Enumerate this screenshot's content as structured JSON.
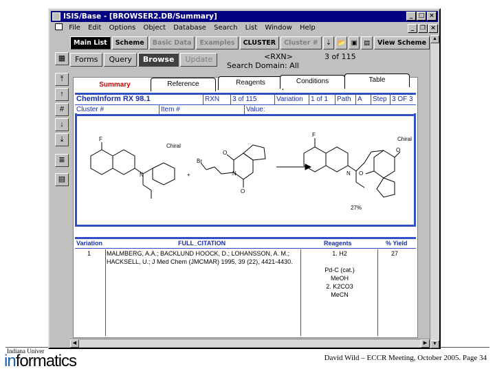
{
  "window": {
    "title": "ISIS/Base - [BROWSER2.DB/Summary]"
  },
  "menu": [
    "File",
    "Edit",
    "Options",
    "Object",
    "Database",
    "Search",
    "List",
    "Window",
    "Help"
  ],
  "toolbar": [
    "Main List",
    "Scheme",
    "Basic Data",
    "Examples",
    "CLUSTER",
    "Cluster #"
  ],
  "toolbar_right": "View Scheme",
  "nav": [
    "Forms",
    "Query",
    "Browse",
    "Update"
  ],
  "record": {
    "rxn": "<RXN>",
    "count": "3   of 115",
    "domain": "Search Domain: All"
  },
  "tabs": [
    "Summary",
    "Reference",
    "Reagents",
    "Conditions",
    "Table"
  ],
  "row1": {
    "db": "ChemInform RX 98.1",
    "rxn_label": "RXN",
    "rxn_val": "3 of 115",
    "variation_label": "Variation",
    "variation_val": "1 of 1",
    "path_label": "Path",
    "path_val": "A",
    "step_label": "Step",
    "step_val": "3 OF 3"
  },
  "row2": {
    "cluster": "Cluster #",
    "item": "Item #",
    "value": "Value:"
  },
  "reaction": {
    "chiral_left": "Chiral",
    "chiral_right": "Chiral",
    "yield": "27%",
    "f1": "F",
    "f2": "F",
    "br": "Br",
    "o": "O",
    "n": "N",
    "plus": "+"
  },
  "citation_head": {
    "variation": "Variation",
    "full": "FULL_CITATION",
    "reagents": "Reagents",
    "yield": "% Yield"
  },
  "citation": {
    "variation": "1",
    "text_1": "MALMBERG, A.A.; BACKLUND HOOCK, D.; LOHANSSON, A. M.;",
    "text_2": "HACKSELL, U.; J Med Chem (JMCMAR) 1995, 39 (22), 4421-4430.",
    "reagents": [
      "1. H2",
      "",
      "Pd-C (cat.)",
      "MeOH",
      "2. K2CO3",
      "MeCN"
    ],
    "yield": "27"
  },
  "slide": {
    "org": "Indiana Univer",
    "logo_1": "in",
    "logo_2": "formatics",
    "footer": "David Wild – ECCR Meeting, October 2005.  Page 34"
  }
}
